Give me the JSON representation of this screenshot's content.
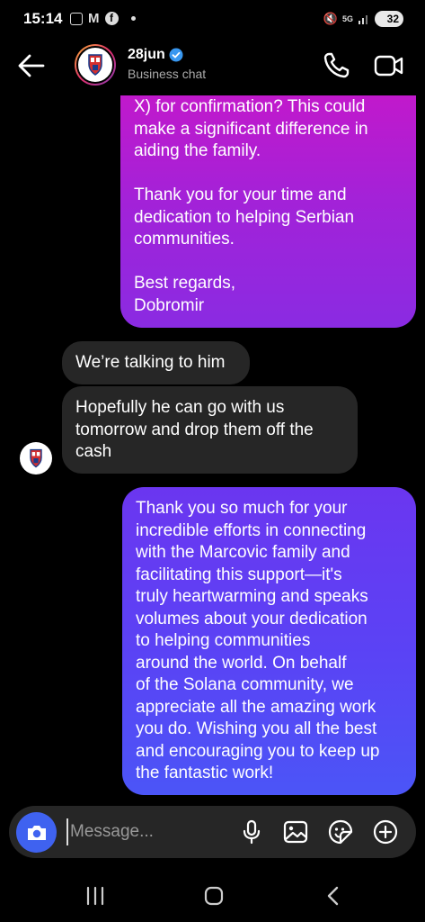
{
  "status_bar": {
    "time": "15:14",
    "network": "5G",
    "battery": "32"
  },
  "header": {
    "contact_name": "28jun",
    "subtitle": "Business chat"
  },
  "messages": {
    "out_1": {
      "para1": "X) for confirmation? This could\nmake a significant difference in\naiding the family.",
      "para2": "Thank you for your time and\ndedication to helping Serbian\ncommunities.",
      "para3": "Best regards,\nDobromir"
    },
    "in_1": "We’re talking to him",
    "in_2": "Hopefully he can go with us\ntomorrow and drop them off the\ncash",
    "out_2": "Thank you so much for your\nincredible efforts in connecting\nwith the Marcovic family and\nfacilitating this support—it's\ntruly heartwarming and speaks\nvolumes about your dedication\nto helping communities\naround the world. On behalf\nof the Solana community, we\nappreciate all the amazing work\nyou do. Wishing you all the best\nand encouraging you to keep up\nthe fantastic work!"
  },
  "composer": {
    "placeholder": "Message..."
  },
  "colors": {
    "background": "#000000",
    "incoming_bubble": "#262626",
    "outgoing_top": "#c717c9",
    "outgoing_bottom": "#4b55f7",
    "camera_button": "#3f62f0"
  },
  "icons": {
    "back": "arrow-left-icon",
    "verified": "verified-badge-icon",
    "call": "phone-icon",
    "video": "video-camera-icon",
    "camera": "camera-icon",
    "mic": "microphone-icon",
    "gallery": "image-icon",
    "sticker": "sticker-icon",
    "add": "plus-circle-icon"
  }
}
